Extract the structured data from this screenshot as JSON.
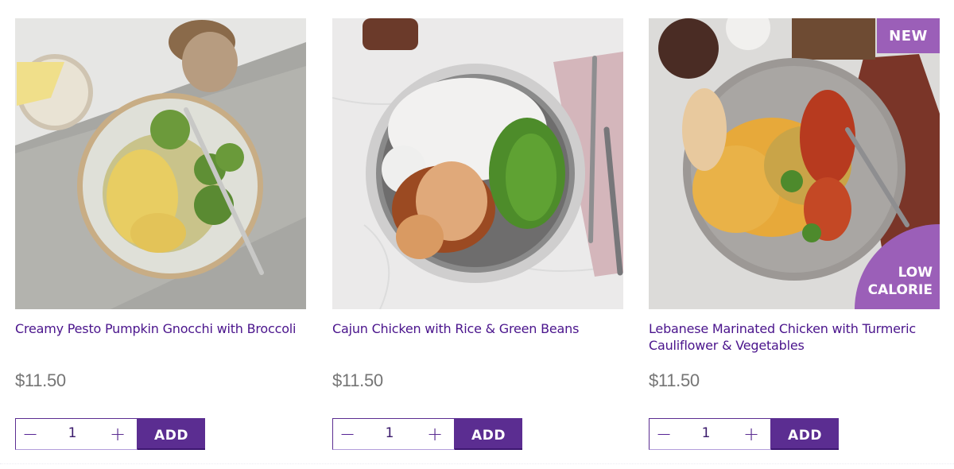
{
  "products": [
    {
      "title": "Creamy Pesto Pumpkin Gnocchi with Broccoli",
      "price": "$11.50",
      "quantity": "1",
      "minus_label": "−",
      "plus_label": "+",
      "add_label": "ADD",
      "image_alt": "Creamy Pesto Pumpkin Gnocchi with Broccoli",
      "badges": []
    },
    {
      "title": "Cajun Chicken with Rice & Green Beans",
      "price": "$11.50",
      "quantity": "1",
      "minus_label": "−",
      "plus_label": "+",
      "add_label": "ADD",
      "image_alt": "Cajun Chicken with Rice & Green Beans",
      "badges": []
    },
    {
      "title": "Lebanese Marinated Chicken with Turmeric Cauliflower & Vegetables",
      "price": "$11.50",
      "quantity": "1",
      "minus_label": "−",
      "plus_label": "+",
      "add_label": "ADD",
      "image_alt": "Lebanese Marinated Chicken with Turmeric Cauliflower & Vegetables",
      "badges": [
        "NEW",
        "LOW CALORIE"
      ],
      "badge_new": "NEW",
      "badge_low_line1": "LOW",
      "badge_low_line2": "CALORIE"
    }
  ],
  "colors": {
    "brand_purple": "#5b2d91",
    "title_purple": "#4a148c",
    "badge_purple": "#9b5fb8",
    "price_gray": "#757575"
  }
}
